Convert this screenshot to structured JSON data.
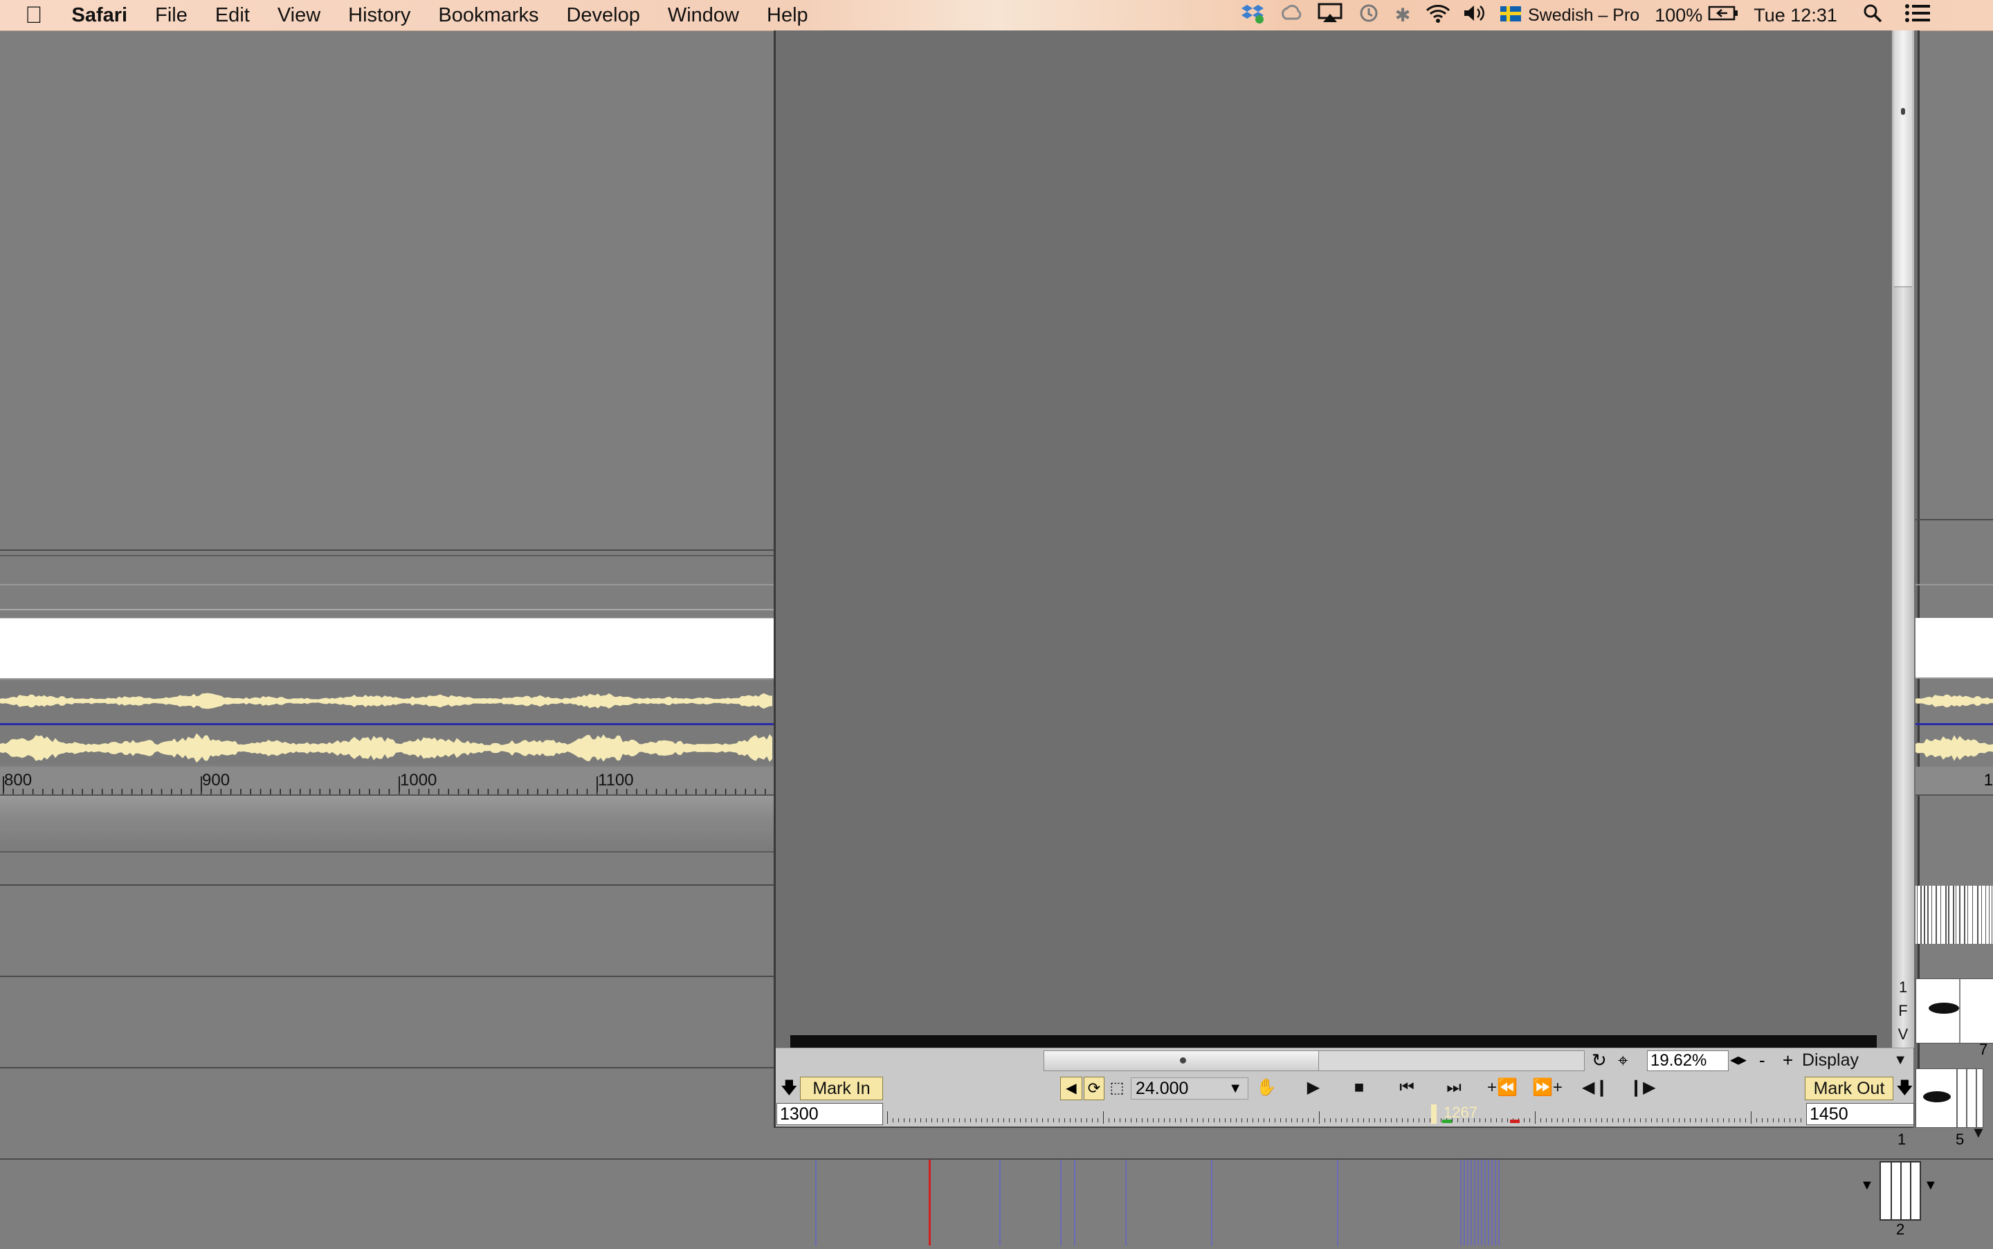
{
  "menubar": {
    "app": "Safari",
    "items": [
      "File",
      "Edit",
      "View",
      "History",
      "Bookmarks",
      "Develop",
      "Window",
      "Help"
    ],
    "status": {
      "input_source": "Swedish – Pro",
      "battery": "100%",
      "clock": "Tue 12:31"
    }
  },
  "ruler": {
    "labels": [
      "800",
      "900",
      "1000",
      "1100"
    ]
  },
  "viewer": {
    "zoom": "19.62%",
    "display_label": "Display",
    "side_letters": [
      "1",
      "F",
      "V"
    ],
    "zoom_minus": "-",
    "zoom_plus": "+"
  },
  "transport": {
    "mark_in_label": "Mark In",
    "mark_out_label": "Mark Out",
    "fps": "24.000",
    "in_value": "1300",
    "out_value": "1450",
    "current_frame": "1267"
  },
  "right_strip": {
    "labels": [
      "7",
      "1",
      "5",
      "2"
    ]
  },
  "colors": {
    "waveform": "#f6ebb6",
    "playhead": "#d22020",
    "marker": "#6a6ab8",
    "mark_button": "#f7e7a6"
  }
}
